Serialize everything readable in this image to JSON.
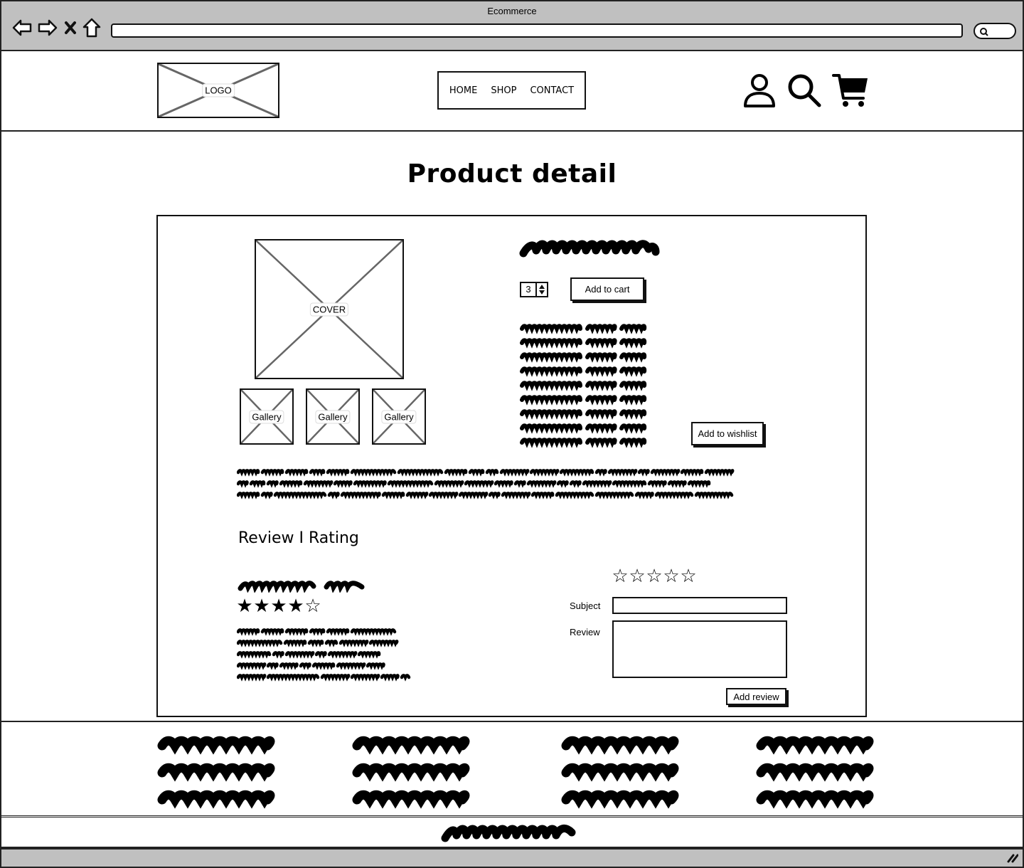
{
  "browser": {
    "window_title": "Ecommerce",
    "nav_icons": [
      "back-arrow-icon",
      "forward-arrow-icon",
      "stop-icon",
      "home-icon"
    ],
    "url": "",
    "search_icon": "search-icon"
  },
  "header": {
    "logo_label": "LOGO",
    "nav": [
      {
        "label": "HOME"
      },
      {
        "label": "SHOP"
      },
      {
        "label": "CONTACT"
      }
    ],
    "icons": [
      "user-icon",
      "search-icon",
      "cart-icon"
    ]
  },
  "page": {
    "title": "Product detail"
  },
  "product": {
    "cover_label": "COVER",
    "gallery": [
      {
        "label": "Gallery"
      },
      {
        "label": "Gallery"
      },
      {
        "label": "Gallery"
      }
    ],
    "quantity": "3",
    "add_to_cart_label": "Add to cart",
    "add_to_wishlist_label": "Add to wishlist",
    "details_lines": 9,
    "description_lines": 3
  },
  "reviews": {
    "heading": "Review I Rating",
    "existing_review": {
      "rating": 4,
      "max_rating": 5,
      "body_lines": 5
    },
    "form": {
      "rating": 0,
      "max_rating": 5,
      "subject_label": "Subject",
      "subject_value": "",
      "review_label": "Review",
      "review_value": "",
      "submit_label": "Add review"
    }
  },
  "footer": {
    "columns": 4,
    "lines_per_column": 3
  },
  "colors": {
    "chrome": "#c0c0c0",
    "ink": "#111111",
    "placeholder_cross": "#666666"
  }
}
